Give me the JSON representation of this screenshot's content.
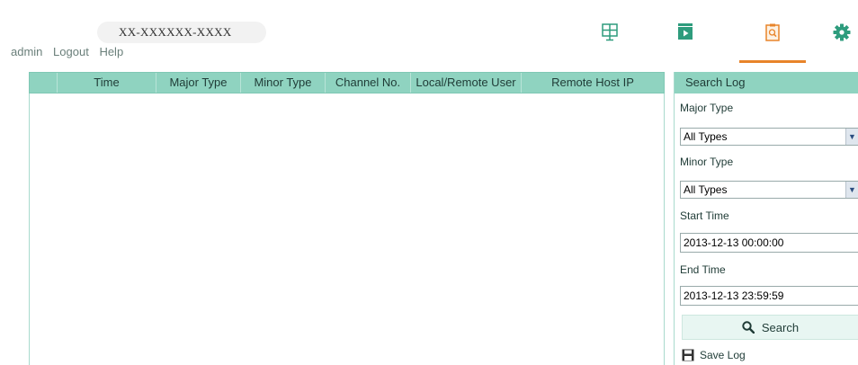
{
  "header": {
    "device_name": "XX-XXXXXX-XXXX",
    "user_links": [
      "admin",
      "Logout",
      "Help"
    ]
  },
  "nav": [
    {
      "icon": "live-view-icon",
      "label": "Live View",
      "active": false
    },
    {
      "icon": "playback-icon",
      "label": "Playback",
      "active": false
    },
    {
      "icon": "log-icon",
      "label": "Log",
      "active": true
    },
    {
      "icon": "gear-icon",
      "label": "Configuration",
      "active": false
    }
  ],
  "colors": {
    "header_bg": "#8fd3c0",
    "active_tab": "#e8842a",
    "icon": "#2e9c7d"
  },
  "log_table": {
    "columns": [
      "Time",
      "Major Type",
      "Minor Type",
      "Channel No.",
      "Local/Remote User",
      "Remote Host IP"
    ],
    "rows": []
  },
  "search_panel": {
    "title": "Search Log",
    "major_type_label": "Major Type",
    "major_type_value": "All Types",
    "minor_type_label": "Minor Type",
    "minor_type_value": "All Types",
    "start_time_label": "Start Time",
    "start_time_value": "2013-12-13 00:00:00",
    "end_time_label": "End Time",
    "end_time_value": "2013-12-13 23:59:59",
    "search_button": "Search",
    "save_log": "Save Log"
  }
}
